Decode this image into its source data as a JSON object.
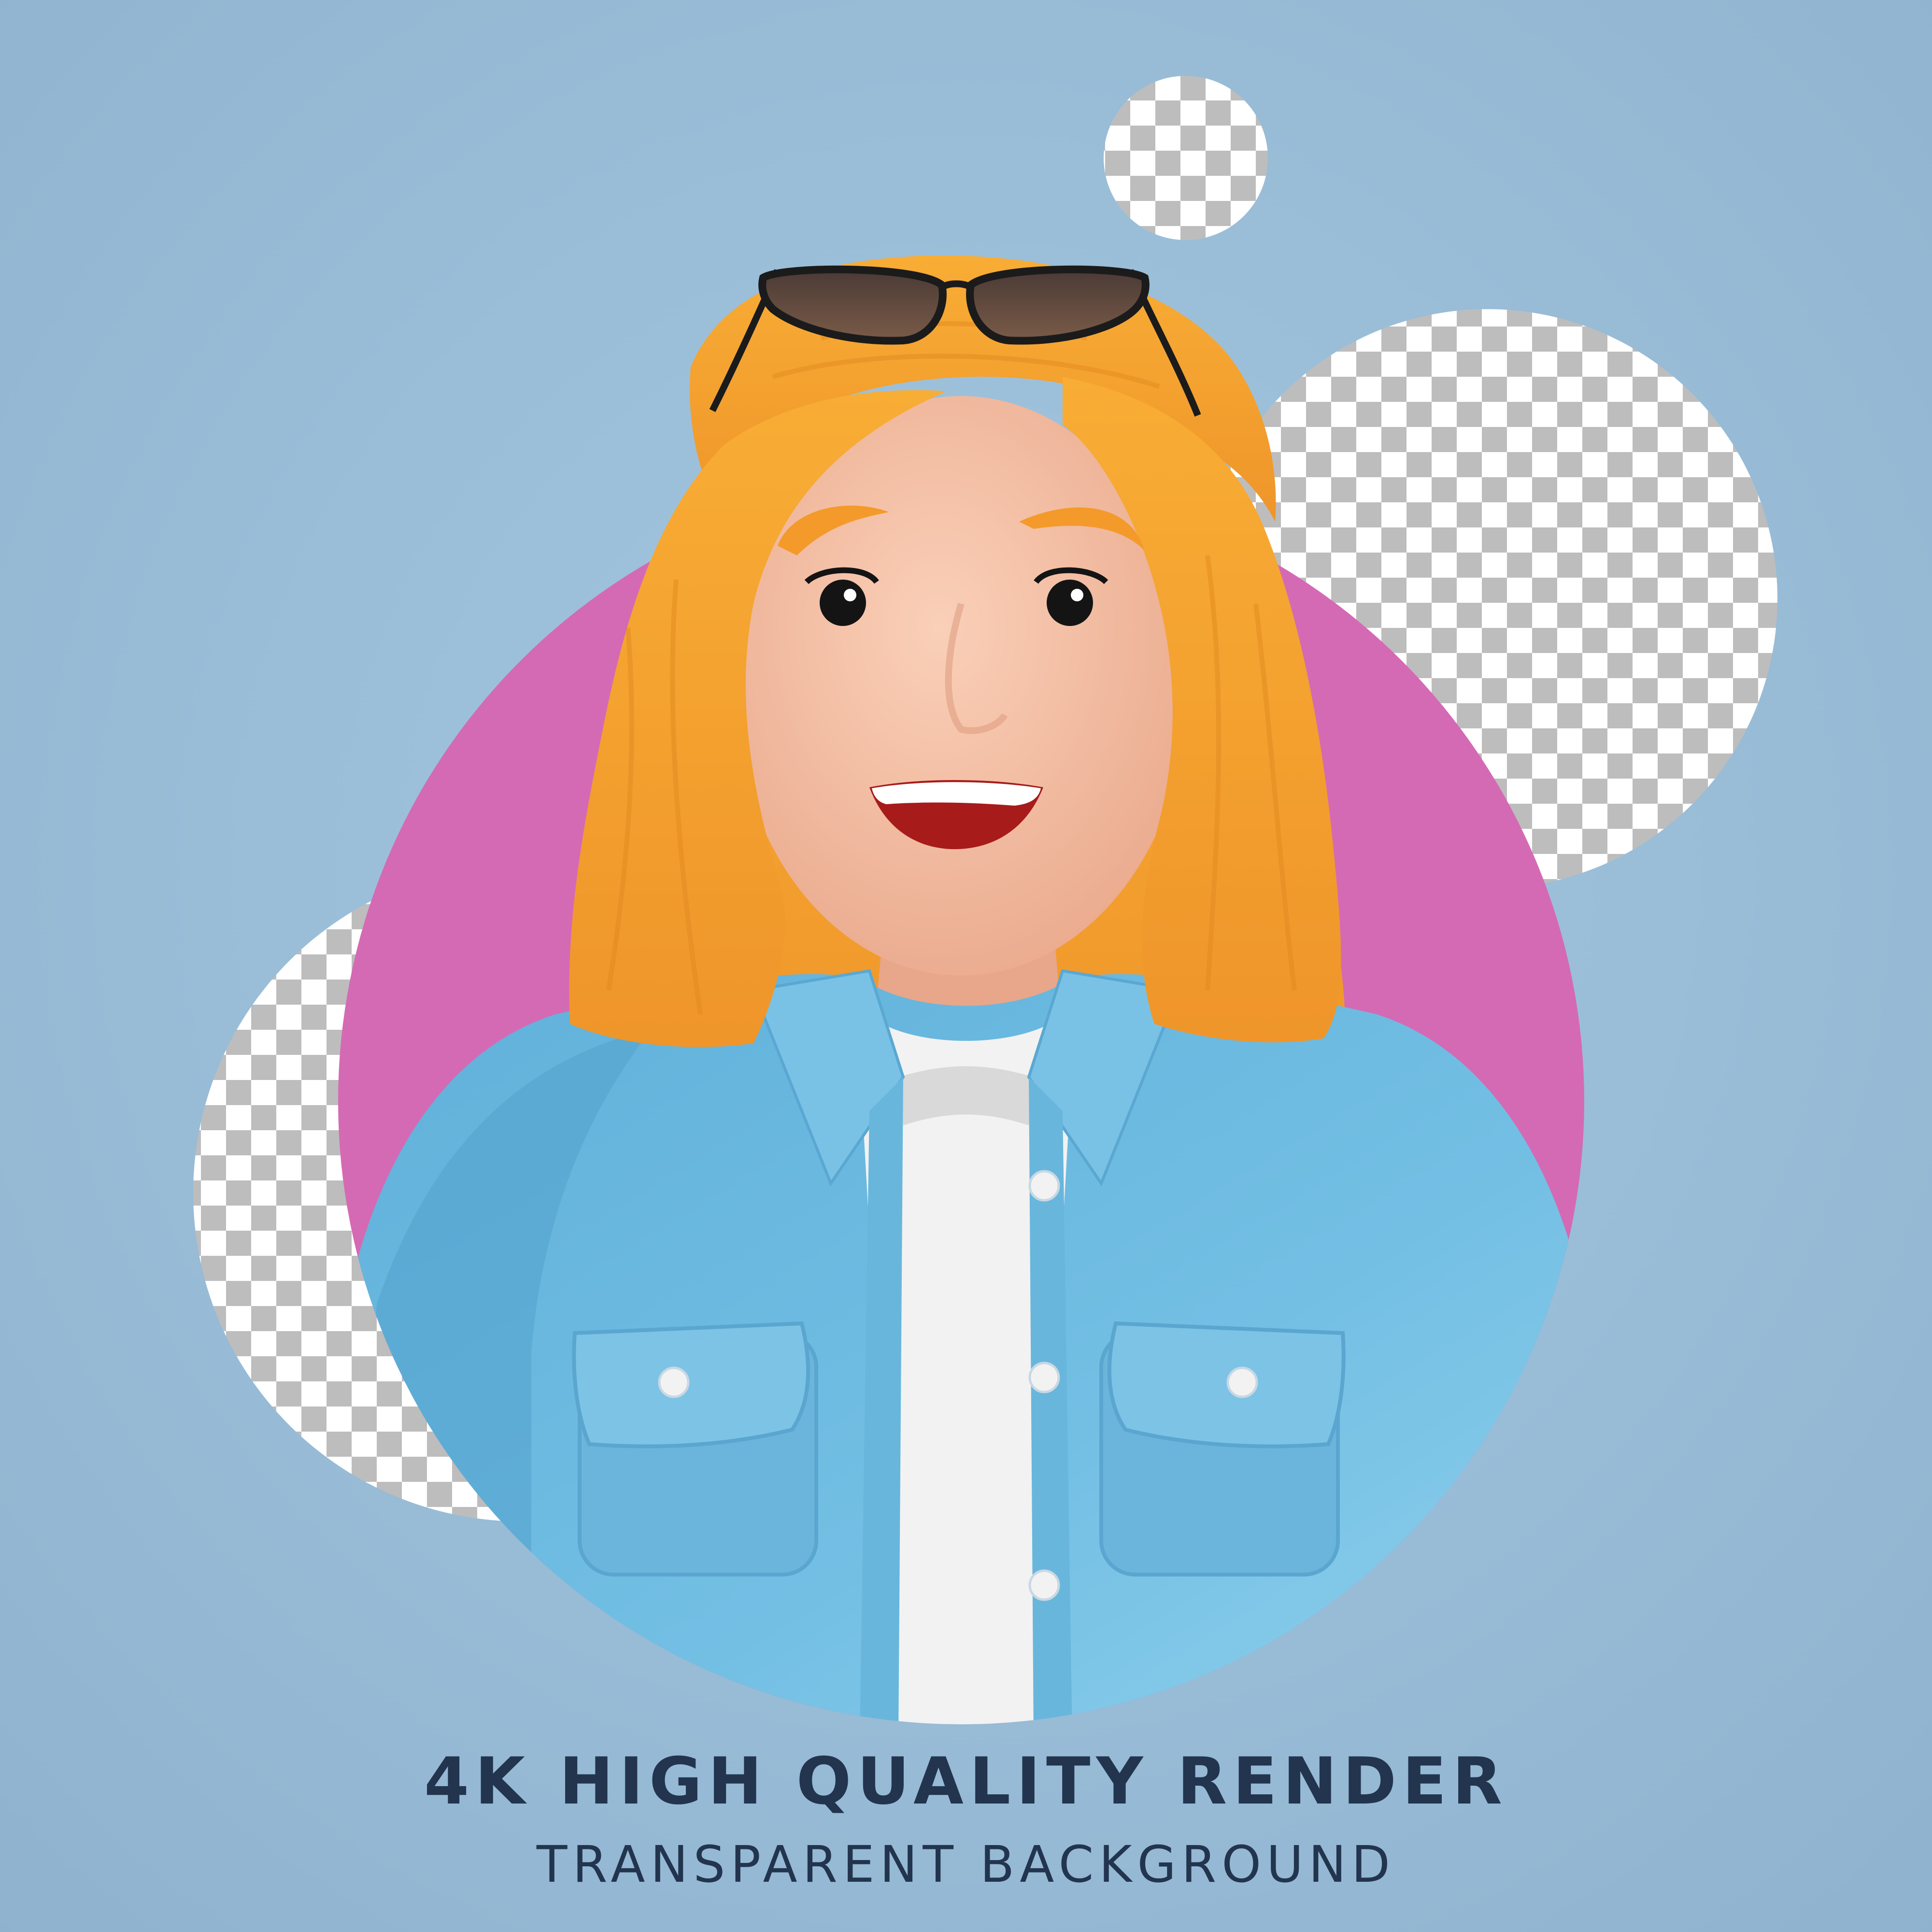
{
  "caption": {
    "headline": "4K HIGH QUALITY RENDER",
    "subheadline": "TRANSPARENT BACKGROUND"
  },
  "colors": {
    "background": "#94bad6",
    "pink_circle": "#d46ab4",
    "checker_light": "#ffffff",
    "checker_dark": "#bdbdbd",
    "hair": "#f4a12f",
    "skin": "#f4bea4",
    "shirt": "#6db6dc",
    "tshirt": "#f2f2f2",
    "text": "#22344e"
  },
  "character": {
    "accessory": "sunglasses-icon",
    "expression": "smile"
  }
}
